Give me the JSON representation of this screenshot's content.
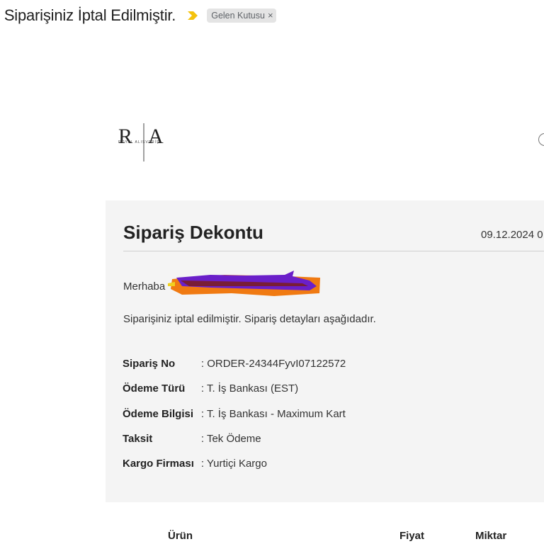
{
  "subject": {
    "title": "ı Siparişiniz İptal Edilmiştir.",
    "importance_color": "#f4c20d",
    "label": "Gelen Kutusu",
    "label_close": "×"
  },
  "logo": {
    "letters": "R|A",
    "wordmark": "ROYAL ALIŞVERİŞ"
  },
  "receipt": {
    "title": "Sipariş Dekontu",
    "date": "09.12.2024 0",
    "greeting": "Merhaba",
    "intro": "Siparişiniz iptal edilmiştir. Sipariş detayları aşağıdadır.",
    "details": [
      {
        "label": "Sipariş No",
        "value": ": ORDER-24344FyvI07122572"
      },
      {
        "label": "Ödeme Türü",
        "value": ": T. İş Bankası (EST)"
      },
      {
        "label": "Ödeme Bilgisi",
        "value": ": T. İş Bankası - Maximum Kart"
      },
      {
        "label": "Taksit",
        "value": ": Tek Ödeme"
      },
      {
        "label": "Kargo Firması",
        "value": ": Yurtiçi Kargo"
      }
    ]
  },
  "items_table": {
    "columns": [
      "Ürün",
      "Fiyat",
      "Miktar"
    ]
  }
}
